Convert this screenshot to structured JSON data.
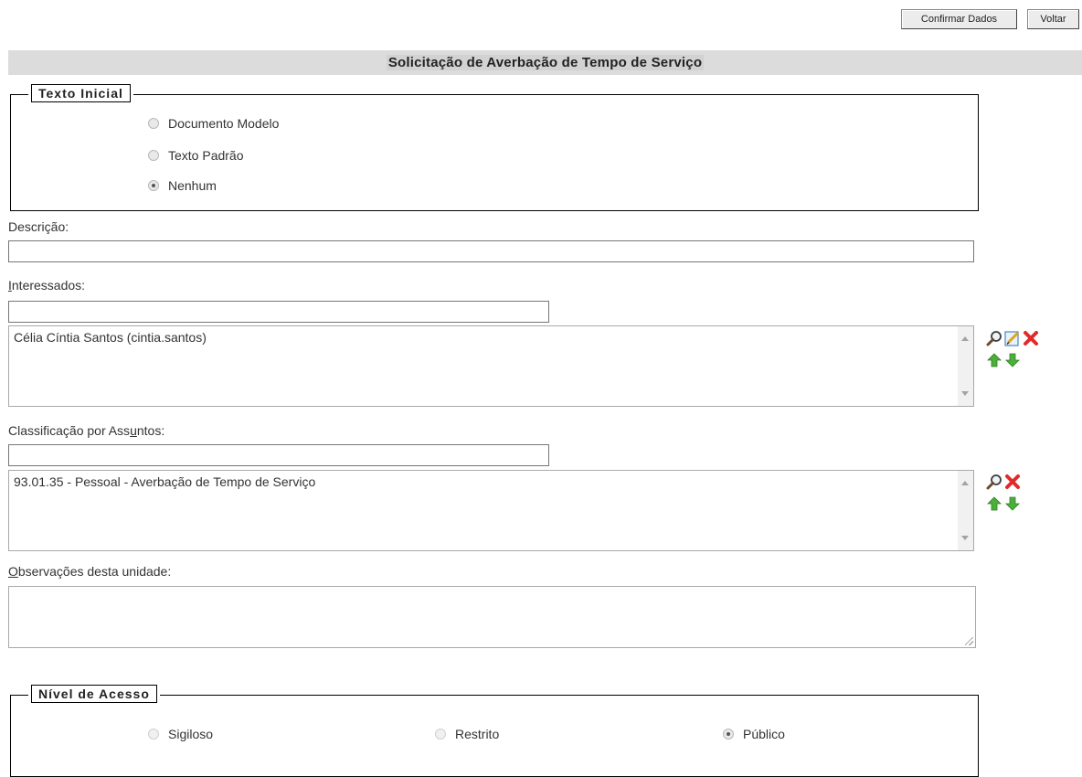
{
  "toolbar": {
    "confirm_button": "Confirmar Dados",
    "back_button": "Voltar"
  },
  "page_title": "Solicitação de Averbação de Tempo de Serviço",
  "texto_inicial": {
    "legend": "Texto Inicial",
    "options": [
      {
        "label": "Documento Modelo",
        "checked": false
      },
      {
        "label": "Texto Padrão",
        "checked": false
      },
      {
        "label": "Nenhum",
        "checked": true
      }
    ]
  },
  "descricao": {
    "label": "Descrição:",
    "value": ""
  },
  "interessados": {
    "label_first": "I",
    "label_rest": "nteressados:",
    "search_value": "",
    "selected_items": [
      "Célia Cíntia Santos (cintia.santos)"
    ],
    "icons": [
      "search-icon",
      "edit-icon",
      "remove-icon",
      "move-up-icon",
      "move-down-icon"
    ]
  },
  "classificacao": {
    "label_before": "Classificação por Ass",
    "label_accel": "u",
    "label_after": "ntos:",
    "search_value": "",
    "selected_items": [
      "93.01.35 - Pessoal - Averbação de Tempo de Serviço"
    ],
    "icons": [
      "search-icon",
      "remove-icon",
      "move-up-icon",
      "move-down-icon"
    ]
  },
  "observacoes": {
    "label_first": "O",
    "label_rest": "bservações desta unidade:",
    "value": ""
  },
  "nivel_acesso": {
    "legend": "Nível de Acesso",
    "options": [
      {
        "label": "Sigiloso",
        "checked": false
      },
      {
        "label": "Restrito",
        "checked": false
      },
      {
        "label": "Público",
        "checked": true
      }
    ]
  }
}
